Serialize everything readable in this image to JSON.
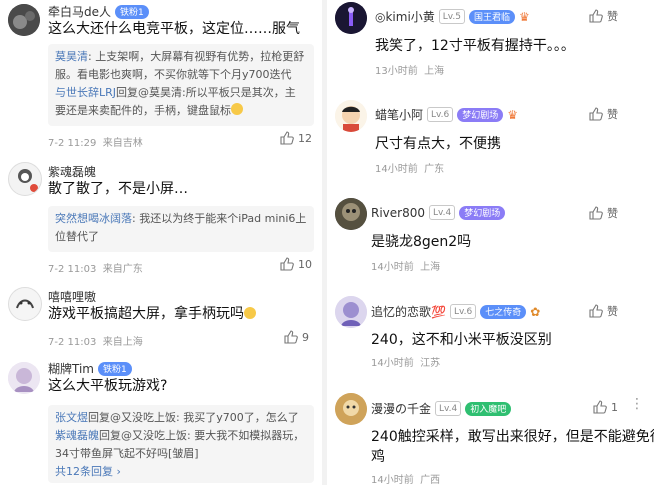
{
  "left": [
    {
      "user": "牵白马de人",
      "badge": "铁粉1",
      "text": "这么大还什么电竞平板，这定位……服气",
      "replies": [
        [
          "莫昊清",
          ": 上支架啊，大屏幕有视野有优势，拉枪更舒"
        ],
        [
          "",
          "服。看电影也爽啊，不买你就等下个月y700迭代"
        ],
        [
          "与世长辞LRJ",
          "回复@莫昊清:所以平板只是其次，主"
        ],
        [
          "",
          "要还是来卖配件的，手柄，键盘鼠标"
        ]
      ],
      "time": "7-2 11:29",
      "location": "来自吉林",
      "likes": "12"
    },
    {
      "user": "紫魂磊魄",
      "text": "散了散了，不是小屏…",
      "replies": [
        [
          "突然想喝冰阔落",
          ": 我还以为终于能来个iPad mini6上"
        ],
        [
          "",
          "位替代了"
        ]
      ],
      "time": "7-2 11:03",
      "location": "来自广东",
      "likes": "10"
    },
    {
      "user": "嘻嘻哩嗷",
      "text": "游戏平板搞超大屏，拿手柄玩吗",
      "time": "7-2 11:03",
      "location": "来自上海",
      "likes": "9"
    },
    {
      "user": "糊牌Tim",
      "badge": "铁粉1",
      "text": "这么大平板玩游戏?",
      "replies": [
        [
          "张文煜",
          "回复@又没吃上饭: 我买了y700了，怎么了"
        ],
        [
          "紫魂磊魄",
          "回复@又没吃上饭: 要大我不如模拟器玩，"
        ],
        [
          "",
          "34寸带鱼屏飞起不好吗[皱眉]"
        ]
      ],
      "more_replies": "共12条回复"
    }
  ],
  "right": [
    {
      "user": "◎kimi小黄",
      "level": "Lv.5",
      "badge": "国王君临",
      "text": "我笑了，12寸平板有握持干。。。",
      "time": "13小时前",
      "location": "上海",
      "like_label": "赞"
    },
    {
      "user": "蜡笔小阿",
      "level": "Lv.6",
      "badge": "梦幻剧场",
      "text": "尺寸有点大，不便携",
      "time": "14小时前",
      "location": "广东",
      "like_label": "赞"
    },
    {
      "user": "River800",
      "level": "Lv.4",
      "badge": "梦幻剧场",
      "text": "是骁龙8gen2吗",
      "time": "14小时前",
      "location": "上海",
      "like_label": "赞"
    },
    {
      "user": "追忆的恋歌💯",
      "level": "Lv.6",
      "badge": "七之传奇",
      "text": "240，这不和小米平板没区别",
      "time": "14小时前",
      "location": "江苏",
      "like_label": "赞"
    },
    {
      "user": "漫漫の千金",
      "level": "Lv.4",
      "badge": "初入魔吧",
      "text": "240触控采样，敢写出来很好，但是不能避免很辣",
      "text2": "鸡",
      "time": "14小时前",
      "location": "广西",
      "likes": "1"
    }
  ],
  "colors": {
    "accent_blue": "#4a78b8",
    "badge_blue": "#5b8ff9",
    "badge_green": "#2fbf71",
    "badge_purple": "#8b7cf6"
  }
}
